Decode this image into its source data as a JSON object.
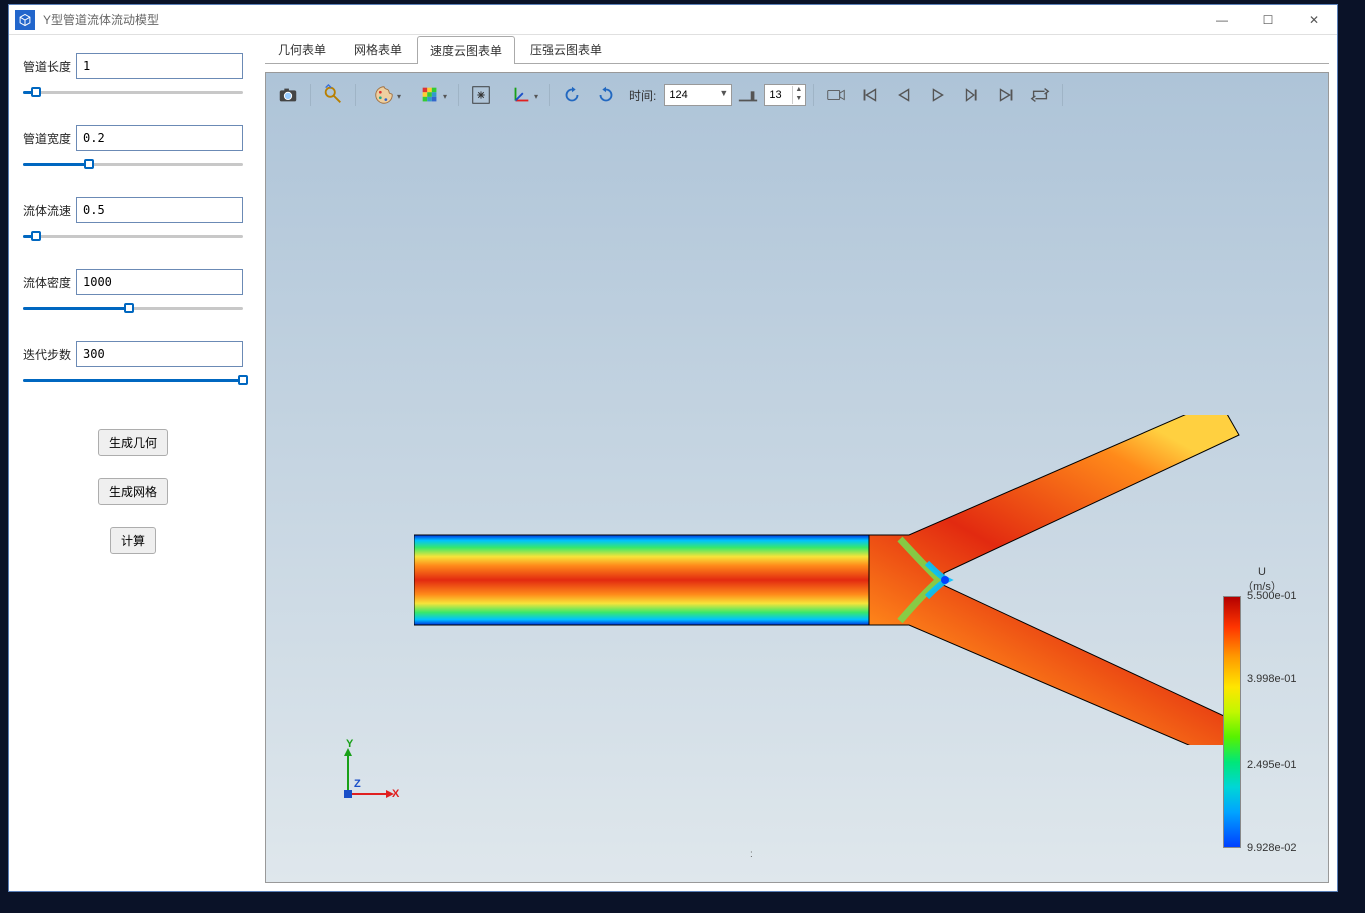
{
  "window": {
    "title": "Y型管道流体流动模型"
  },
  "win_controls": {
    "min": "—",
    "max": "☐",
    "close": "✕"
  },
  "sidebar": {
    "params": [
      {
        "label": "管道长度",
        "value": "1",
        "slider_pct": 6
      },
      {
        "label": "管道宽度",
        "value": "0.2",
        "slider_pct": 30
      },
      {
        "label": "流体流速",
        "value": "0.5",
        "slider_pct": 6
      },
      {
        "label": "流体密度",
        "value": "1000",
        "slider_pct": 48
      },
      {
        "label": "迭代步数",
        "value": "300",
        "slider_pct": 100
      }
    ],
    "buttons": {
      "gen_geom": "生成几何",
      "gen_mesh": "生成网格",
      "compute": "计算"
    }
  },
  "tabs": [
    {
      "label": "几何表单",
      "active": false
    },
    {
      "label": "网格表单",
      "active": false
    },
    {
      "label": "速度云图表单",
      "active": true
    },
    {
      "label": "压强云图表单",
      "active": false
    }
  ],
  "toolbar": {
    "time_label": "时间:",
    "time_value": "124",
    "spin_value": "13"
  },
  "colorbar": {
    "title_line1": "U",
    "title_line2": "（m/s）",
    "ticks": [
      {
        "value": "5.500e-01",
        "pos": 0
      },
      {
        "value": "3.998e-01",
        "pos": 33
      },
      {
        "value": "2.495e-01",
        "pos": 67
      },
      {
        "value": "9.928e-02",
        "pos": 100
      }
    ]
  },
  "axes": {
    "x": "X",
    "y": "Y",
    "z": "Z"
  }
}
